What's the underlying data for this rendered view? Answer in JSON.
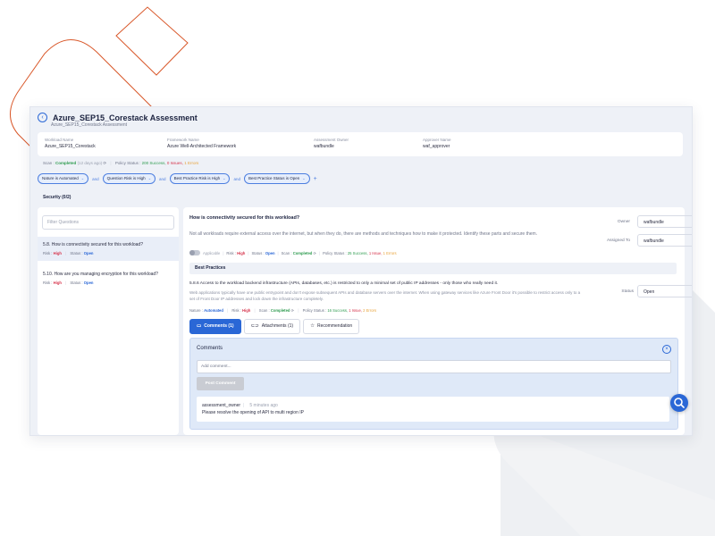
{
  "header": {
    "title": "Azure_SEP15_Corestack Assessment",
    "subtitle": "Azure_SEP15_Corestack Assessment"
  },
  "info": {
    "workload_label": "Workload Name",
    "workload_value": "Azure_SEP15_Corestack",
    "framework_label": "Framework Name",
    "framework_value": "Azure Well-Architected Framework",
    "owner_label": "Assessment Owner",
    "owner_value": "wafbundle",
    "approver_label": "Approver Name",
    "approver_value": "waf_approver"
  },
  "scan": {
    "label": "Scan :",
    "status": "Completed",
    "ago": "(12 days ago)",
    "policy_label": "Policy Status :",
    "success": "200 Success,",
    "issues": "0 Issues,",
    "errors": "1 Errors"
  },
  "filters": {
    "chips": [
      "Nature is Automated",
      "Question Risk is High",
      "Best Practice Risk is High",
      "Best Practice Status is Open"
    ],
    "joiner": "and"
  },
  "section": {
    "title": "Security (0/2)"
  },
  "left": {
    "filter_placeholder": "Filter Questions",
    "questions": [
      {
        "text": "5.8. How is connectivity secured for this workload?",
        "risk_label": "Risk :",
        "risk": "High",
        "status_label": "Status :",
        "status": "Open"
      },
      {
        "text": "5.10. How are you managing encryption for this workload?",
        "risk_label": "Risk :",
        "risk": "High",
        "status_label": "Status :",
        "status": "Open"
      }
    ]
  },
  "question": {
    "title": "How is connectivity secured for this workload?",
    "description": "Not all workloads require external access over the internet, but when they do, there are methods and techniques how to make it protected. Identify these parts and secure them.",
    "owner_label": "Owner",
    "owner_value": "wafbundle",
    "assigned_label": "Assigned To",
    "assigned_value": "wafbundle",
    "applicable": "Applicable",
    "risk_label": "Risk :",
    "risk": "High",
    "status_label": "Status :",
    "status": "Open",
    "scan_label": "Scan :",
    "scan_status": "Completed",
    "policy_label": "Policy Status :",
    "success": "25 Success,",
    "issues": "1 Issue,",
    "errors": "1 Errors"
  },
  "best_practice": {
    "header": "Best Practices",
    "title": "5.8.6 Access to the workload backend infrastructure (APIs, databases, etc.) is restricted to only a minimal set of public IP addresses - only those who really need it.",
    "description": "Web applications typically have one public entrypoint and don't expose subsequent APIs and database servers over the internet. When using gateway services like Azure Front Door it's possible to restrict access only to a set of Front Door IP addresses and lock down the infrastructure completely.",
    "status_label": "Status",
    "status_value": "Open",
    "nature_label": "Nature :",
    "nature": "Automated",
    "risk_label": "Risk :",
    "risk": "High",
    "scan_label": "Scan :",
    "scan_status": "Completed",
    "policy_label": "Policy Status :",
    "success": "16 Success,",
    "issues": "1 Issue,",
    "errors": "2 Errors"
  },
  "tabs": {
    "comments": "Comments (1)",
    "attachments": "Attachments (1)",
    "recommendation": "Recommendation"
  },
  "comments": {
    "title": "Comments",
    "placeholder": "Add comment...",
    "post_label": "Post Comment",
    "items": [
      {
        "author": "assessment_owner",
        "time": "5 minutes ago",
        "text": "Please resolve the opening of API to multi region IP"
      }
    ]
  },
  "colors": {
    "accent": "#2a67d6",
    "risk_high": "#d6334b",
    "success": "#2e9b4f",
    "deco_orange": "#d9582a",
    "deco_gray": "#eef0f3"
  }
}
